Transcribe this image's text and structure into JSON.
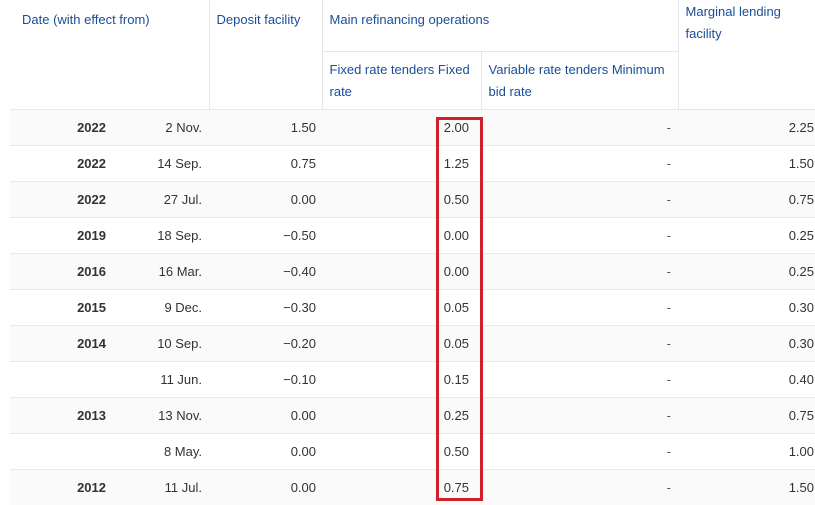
{
  "headers": {
    "date": "Date (with effect from)",
    "deposit": "Deposit facility",
    "mro": "Main refinancing operations",
    "fixed": "Fixed rate tenders Fixed rate",
    "variable": "Variable rate tenders Minimum bid rate",
    "marginal": "Marginal lending facility"
  },
  "rows": [
    {
      "year": "2022",
      "day": "2 Nov.",
      "deposit": "1.50",
      "fixed": "2.00",
      "variable": "-",
      "marginal": "2.25"
    },
    {
      "year": "2022",
      "day": "14 Sep.",
      "deposit": "0.75",
      "fixed": "1.25",
      "variable": "-",
      "marginal": "1.50"
    },
    {
      "year": "2022",
      "day": "27 Jul.",
      "deposit": "0.00",
      "fixed": "0.50",
      "variable": "-",
      "marginal": "0.75"
    },
    {
      "year": "2019",
      "day": "18 Sep.",
      "deposit": "−0.50",
      "fixed": "0.00",
      "variable": "-",
      "marginal": "0.25"
    },
    {
      "year": "2016",
      "day": "16 Mar.",
      "deposit": "−0.40",
      "fixed": "0.00",
      "variable": "-",
      "marginal": "0.25"
    },
    {
      "year": "2015",
      "day": "9 Dec.",
      "deposit": "−0.30",
      "fixed": "0.05",
      "variable": "-",
      "marginal": "0.30"
    },
    {
      "year": "2014",
      "day": "10 Sep.",
      "deposit": "−0.20",
      "fixed": "0.05",
      "variable": "-",
      "marginal": "0.30"
    },
    {
      "year": "",
      "day": "11 Jun.",
      "deposit": "−0.10",
      "fixed": "0.15",
      "variable": "-",
      "marginal": "0.40"
    },
    {
      "year": "2013",
      "day": "13 Nov.",
      "deposit": "0.00",
      "fixed": "0.25",
      "variable": "-",
      "marginal": "0.75"
    },
    {
      "year": "",
      "day": "8 May.",
      "deposit": "0.00",
      "fixed": "0.50",
      "variable": "-",
      "marginal": "1.00"
    },
    {
      "year": "2012",
      "day": "11 Jul.",
      "deposit": "0.00",
      "fixed": "0.75",
      "variable": "-",
      "marginal": "1.50"
    }
  ],
  "highlight": {
    "column": "fixed",
    "color": "#d0202a"
  }
}
